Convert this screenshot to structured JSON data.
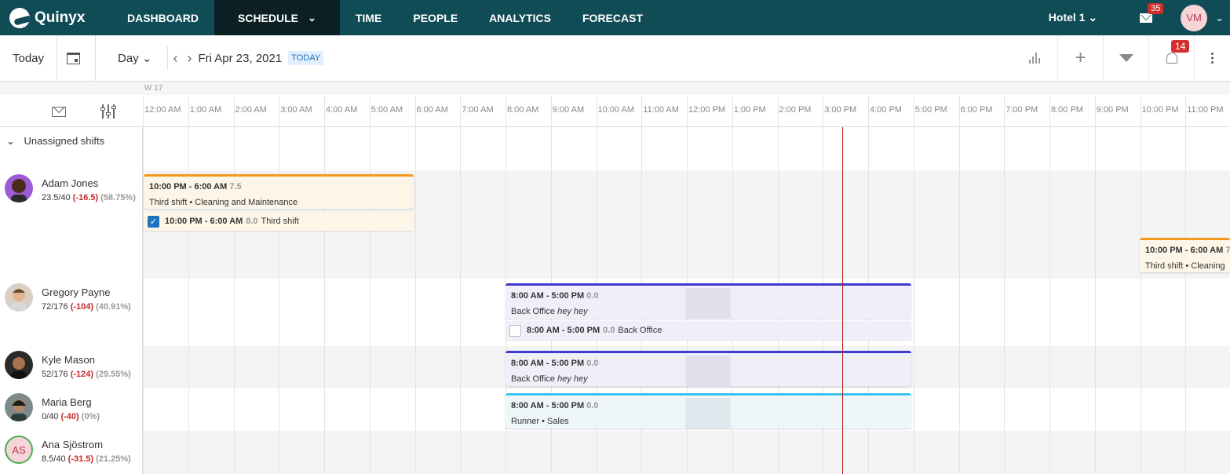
{
  "brand": {
    "name": "Quinyx"
  },
  "nav": {
    "items": [
      {
        "label": "DASHBOARD"
      },
      {
        "label": "SCHEDULE"
      },
      {
        "label": "TIME"
      },
      {
        "label": "PEOPLE"
      },
      {
        "label": "ANALYTICS"
      },
      {
        "label": "FORECAST"
      }
    ],
    "unit": "Hotel 1",
    "mail_count": "35",
    "user_initials": "VM"
  },
  "toolbar": {
    "today_label": "Today",
    "view_label": "Day",
    "date": "Fri Apr 23, 2021",
    "today_badge": "TODAY",
    "notification_count": "14"
  },
  "timeline": {
    "week": "W 17",
    "hours": [
      "12:00 AM",
      "1:00 AM",
      "2:00 AM",
      "3:00 AM",
      "4:00 AM",
      "5:00 AM",
      "6:00 AM",
      "7:00 AM",
      "8:00 AM",
      "9:00 AM",
      "10:00 AM",
      "11:00 AM",
      "12:00 PM",
      "1:00 PM",
      "2:00 PM",
      "3:00 PM",
      "4:00 PM",
      "5:00 PM",
      "6:00 PM",
      "7:00 PM",
      "8:00 PM",
      "9:00 PM",
      "10:00 PM",
      "11:00 PM"
    ]
  },
  "unassigned": {
    "label": "Unassigned shifts"
  },
  "employees": [
    {
      "name": "Adam Jones",
      "hours": "23.5/40",
      "diff": "(-16.5)",
      "pct": "(58.75%)",
      "shifts": [
        {
          "time": "10:00 PM - 6:00 AM",
          "hrs": "7.5",
          "desc": "Third shift • Cleaning and Maintenance",
          "note": ""
        },
        {
          "time": "10:00 PM - 6:00 AM",
          "hrs": "7",
          "desc": "Third shift • Cleaning",
          "note": ""
        }
      ],
      "punch": {
        "time": "10:00 PM - 6:00 AM",
        "hrs": "8.0",
        "desc": "Third shift",
        "checked": true
      }
    },
    {
      "name": "Gregory Payne",
      "hours": "72/176",
      "diff": "(-104)",
      "pct": "(40.91%)",
      "shifts": [
        {
          "time": "8:00 AM - 5:00 PM",
          "hrs": "0.0",
          "desc": "Back Office",
          "note": "hey hey"
        }
      ],
      "punch": {
        "time": "8:00 AM - 5:00 PM",
        "hrs": "0.0",
        "desc": "Back Office",
        "checked": false
      }
    },
    {
      "name": "Kyle Mason",
      "hours": "52/176",
      "diff": "(-124)",
      "pct": "(29.55%)",
      "shifts": [
        {
          "time": "8:00 AM - 5:00 PM",
          "hrs": "0.0",
          "desc": "Back Office",
          "note": "hey hey"
        }
      ]
    },
    {
      "name": "Maria Berg",
      "hours": "0/40",
      "diff": "(-40)",
      "pct": "(0%)",
      "shifts": [
        {
          "time": "8:00 AM - 5:00 PM",
          "hrs": "0.0",
          "desc": "Runner • Sales",
          "note": ""
        }
      ]
    },
    {
      "name": "Ana Sjöstrom",
      "initials": "AS",
      "hours": "8.5/40",
      "diff": "(-31.5)",
      "pct": "(21.25%)"
    }
  ],
  "colors": {
    "nav_bg": "#0f4c55",
    "nav_active": "#0b1f24",
    "third_shift": "#f29a1c",
    "back_office": "#3f3ad0",
    "runner": "#3bc4f0",
    "now_line": "#b71c1c",
    "negative": "#c62828"
  }
}
